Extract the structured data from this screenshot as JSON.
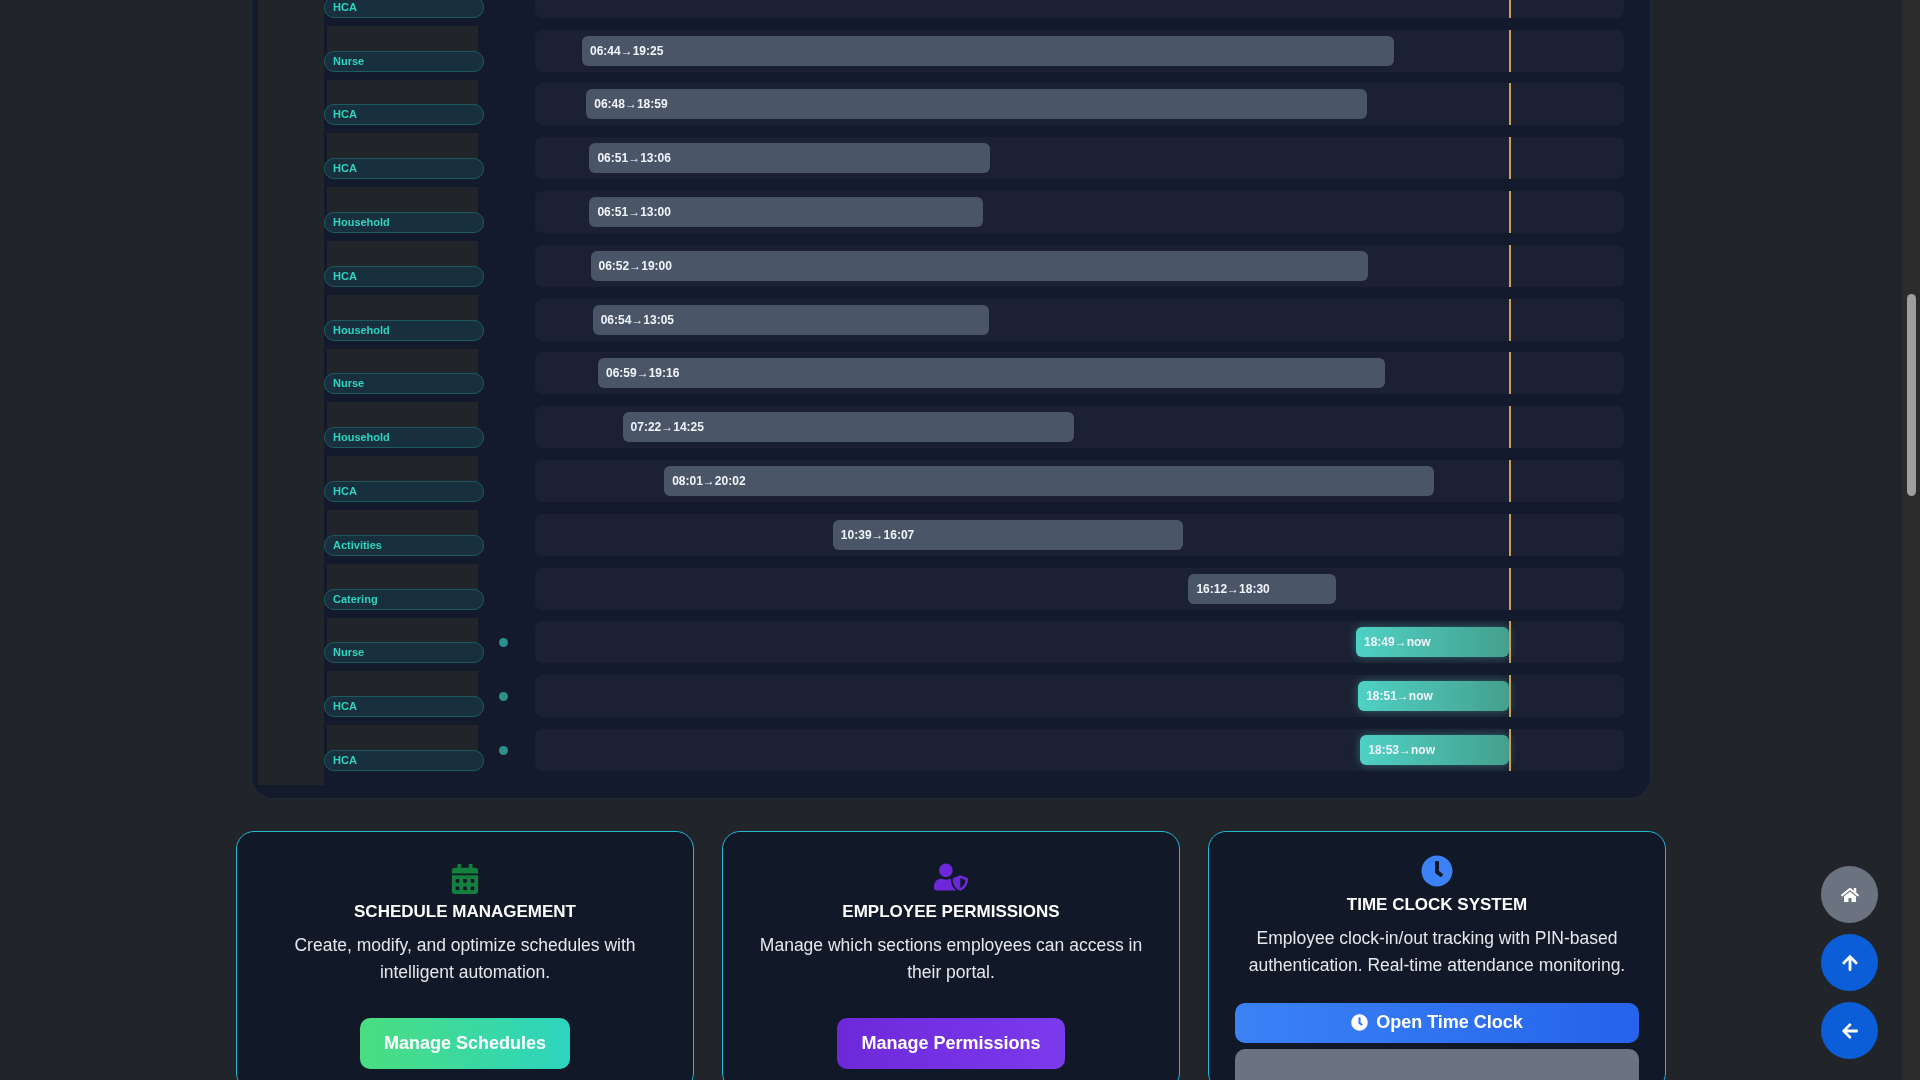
{
  "timeline": {
    "now_marker": {
      "level": 0.894
    },
    "rows": [
      {
        "role": "HCA",
        "active": false
      },
      {
        "role": "Nurse",
        "active": false,
        "shift": "06:44→19:25"
      },
      {
        "role": "HCA",
        "active": false,
        "shift": "06:48→18:59"
      },
      {
        "role": "HCA",
        "active": false,
        "shift": "06:51→13:06"
      },
      {
        "role": "Household",
        "active": false,
        "shift": "06:51→13:00"
      },
      {
        "role": "HCA",
        "active": false,
        "shift": "06:52→19:00"
      },
      {
        "role": "Household",
        "active": false,
        "shift": "06:54→13:05"
      },
      {
        "role": "Nurse",
        "active": false,
        "shift": "06:59→19:16"
      },
      {
        "role": "Household",
        "active": false,
        "shift": "07:22→14:25"
      },
      {
        "role": "HCA",
        "active": false,
        "shift": "08:01→20:02"
      },
      {
        "role": "Activities",
        "active": false,
        "shift": "10:39→16:07"
      },
      {
        "role": "Catering",
        "active": false,
        "shift": "16:12→18:30"
      },
      {
        "role": "Nurse",
        "active": true,
        "shift": "18:49→now"
      },
      {
        "role": "HCA",
        "active": true,
        "shift": "18:51→now"
      },
      {
        "role": "HCA",
        "active": true,
        "shift": "18:53→now"
      }
    ]
  },
  "cards": [
    {
      "kind": "schedule",
      "title": "SCHEDULE MANAGEMENT",
      "description": "Create, modify, and optimize schedules with intelligent automation.",
      "buttons": [
        {
          "kind": "green",
          "label": "Manage Schedules"
        }
      ]
    },
    {
      "kind": "permissions",
      "title": "EMPLOYEE PERMISSIONS",
      "description": "Manage which sections employees can access in their portal.",
      "buttons": [
        {
          "kind": "purple",
          "label": "Manage Permissions"
        }
      ]
    },
    {
      "kind": "clock",
      "title": "TIME CLOCK SYSTEM",
      "description": "Employee clock-in/out tracking with PIN-based authentication. Real-time attendance monitoring.",
      "buttons": [
        {
          "kind": "clock",
          "label": "Open Time Clock"
        },
        {
          "kind": "gray"
        }
      ]
    }
  ],
  "floating_buttons": [
    {
      "kind": "home"
    },
    {
      "kind": "up"
    },
    {
      "kind": "back"
    }
  ]
}
